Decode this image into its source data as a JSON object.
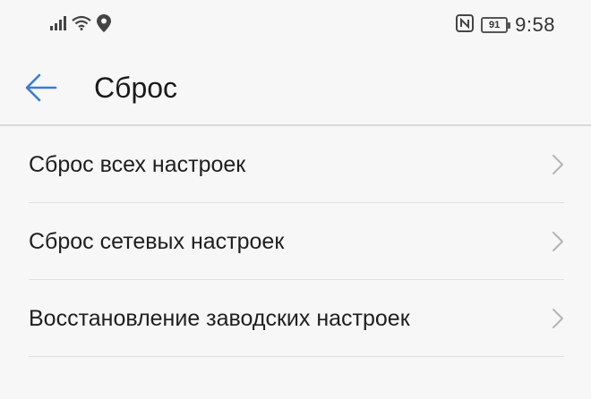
{
  "status_bar": {
    "time": "9:58",
    "battery_level": "91",
    "icons": [
      "signal-icon",
      "wifi-icon",
      "location-icon",
      "nfc-icon",
      "battery-icon"
    ]
  },
  "header": {
    "title": "Сброс",
    "back_icon": "back-arrow-icon",
    "accent_color": "#3a7bd5"
  },
  "items": [
    {
      "label": "Сброс всех настроек",
      "icon": "chevron-right-icon"
    },
    {
      "label": "Сброс сетевых настроек",
      "icon": "chevron-right-icon"
    },
    {
      "label": "Восстановление заводских настроек",
      "icon": "chevron-right-icon"
    }
  ]
}
